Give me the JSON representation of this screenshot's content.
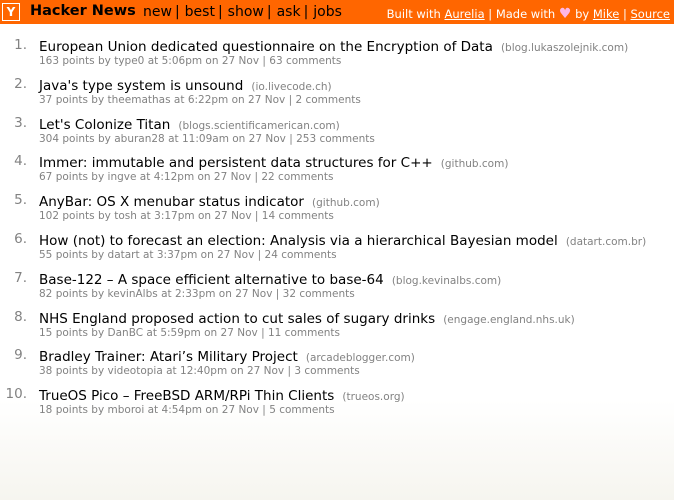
{
  "header": {
    "logo": "Y",
    "brand": "Hacker News",
    "nav": [
      {
        "label": "new"
      },
      {
        "label": "best"
      },
      {
        "label": "show"
      },
      {
        "label": "ask"
      },
      {
        "label": "jobs"
      }
    ],
    "nav_separator": "|",
    "built_with_prefix": "Built with",
    "built_with_link": "Aurelia",
    "made_with_text": "Made with",
    "heart": "♥",
    "by_text": "by",
    "author_link": "Mike",
    "source_link": "Source",
    "separator": "|"
  },
  "stories": [
    {
      "rank": "1.",
      "title": "European Union dedicated questionnaire on the Encryption of Data",
      "domain": "(blog.lukaszolejnik.com)",
      "points": "163 points",
      "by": "by",
      "user": "type0",
      "at": "at",
      "time": "5:06pm on 27 Nov",
      "comments": "63 comments"
    },
    {
      "rank": "2.",
      "title": "Java's type system is unsound",
      "domain": "(io.livecode.ch)",
      "points": "37 points",
      "by": "by",
      "user": "theemathas",
      "at": "at",
      "time": "6:22pm on 27 Nov",
      "comments": "2 comments"
    },
    {
      "rank": "3.",
      "title": "Let's Colonize Titan",
      "domain": "(blogs.scientificamerican.com)",
      "points": "304 points",
      "by": "by",
      "user": "aburan28",
      "at": "at",
      "time": "11:09am on 27 Nov",
      "comments": "253 comments"
    },
    {
      "rank": "4.",
      "title": "Immer: immutable and persistent data structures for C++",
      "domain": "(github.com)",
      "points": "67 points",
      "by": "by",
      "user": "ingve",
      "at": "at",
      "time": "4:12pm on 27 Nov",
      "comments": "22 comments"
    },
    {
      "rank": "5.",
      "title": "AnyBar: OS X menubar status indicator",
      "domain": "(github.com)",
      "points": "102 points",
      "by": "by",
      "user": "tosh",
      "at": "at",
      "time": "3:17pm on 27 Nov",
      "comments": "14 comments"
    },
    {
      "rank": "6.",
      "title": "How (not) to forecast an election: Analysis via a hierarchical Bayesian model",
      "domain": "(datart.com.br)",
      "points": "55 points",
      "by": "by",
      "user": "datart",
      "at": "at",
      "time": "3:37pm on 27 Nov",
      "comments": "24 comments"
    },
    {
      "rank": "7.",
      "title": "Base-122 – A space efficient alternative to base-64",
      "domain": "(blog.kevinalbs.com)",
      "points": "82 points",
      "by": "by",
      "user": "kevinAlbs",
      "at": "at",
      "time": "2:33pm on 27 Nov",
      "comments": "32 comments"
    },
    {
      "rank": "8.",
      "title": "NHS England proposed action to cut sales of sugary drinks",
      "domain": "(engage.england.nhs.uk)",
      "points": "15 points",
      "by": "by",
      "user": "DanBC",
      "at": "at",
      "time": "5:59pm on 27 Nov",
      "comments": "11 comments"
    },
    {
      "rank": "9.",
      "title": "Bradley Trainer: Atari’s Military Project",
      "domain": "(arcadeblogger.com)",
      "points": "38 points",
      "by": "by",
      "user": "videotopia",
      "at": "at",
      "time": "12:40pm on 27 Nov",
      "comments": "3 comments"
    },
    {
      "rank": "10.",
      "title": "TrueOS Pico – FreeBSD ARM/RPi Thin Clients",
      "domain": "(trueos.org)",
      "points": "18 points",
      "by": "by",
      "user": "mboroi",
      "at": "at",
      "time": "4:54pm on 27 Nov",
      "comments": "5 comments"
    }
  ],
  "colors": {
    "header_bg": "#ff6600",
    "meta_text": "#828282",
    "heart": "#ffb6e6"
  }
}
